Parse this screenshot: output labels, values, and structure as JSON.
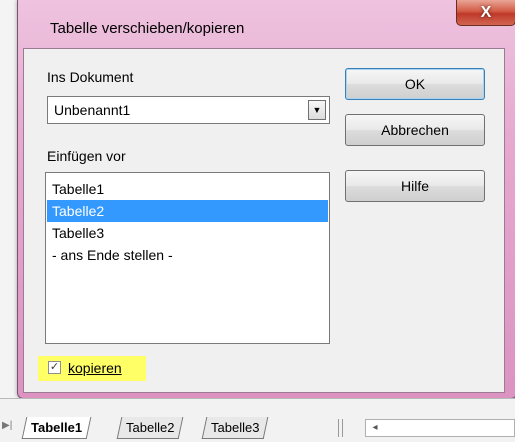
{
  "dialog": {
    "title": "Tabelle verschieben/kopieren",
    "close_glyph": "X",
    "document_label": "Ins Dokument",
    "document_value": "Unbenannt1",
    "insert_before_label": "Einfügen vor",
    "list_items": [
      "Tabelle1",
      "Tabelle2",
      "Tabelle3",
      "- ans Ende stellen -"
    ],
    "selected_index": 1,
    "buttons": {
      "ok": "OK",
      "cancel": "Abbrechen",
      "help": "Hilfe"
    },
    "copy_checkbox": {
      "label": "kopieren",
      "checked": true
    }
  },
  "sheetbar": {
    "tabs": [
      "Tabelle1",
      "Tabelle2",
      "Tabelle3"
    ],
    "active_index": 0
  },
  "colors": {
    "selection": "#3399ff",
    "highlight": "#ffff66",
    "close_button": "#c0392b"
  }
}
